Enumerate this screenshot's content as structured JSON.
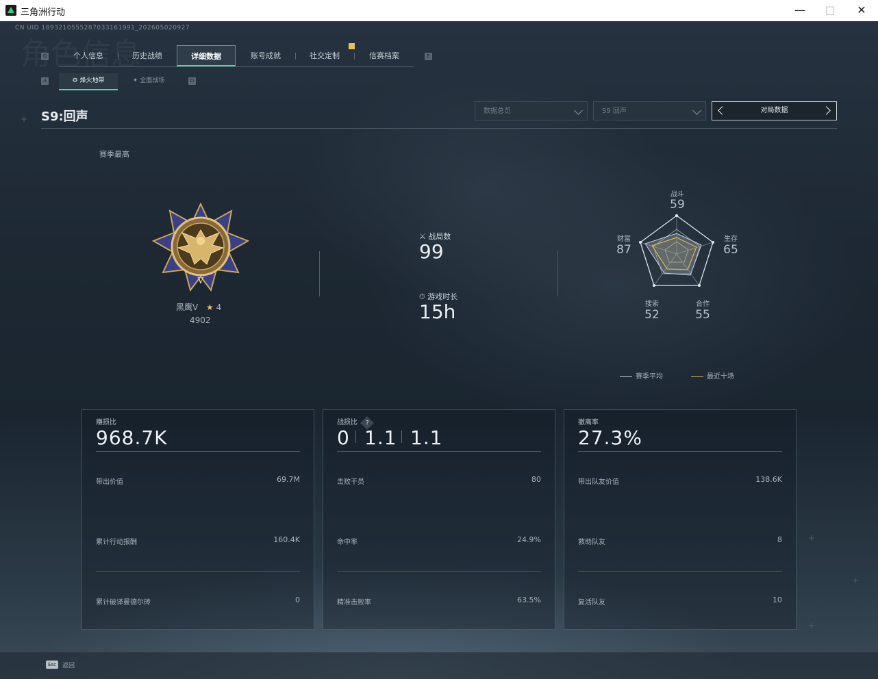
{
  "window": {
    "title": "三角洲行动"
  },
  "header": {
    "uid": "CN UID 1893210555287033161991_202605020927",
    "bg_title": "角色信息"
  },
  "tabs": [
    {
      "label": "个人信息"
    },
    {
      "label": "历史战绩"
    },
    {
      "label": "详细数据",
      "active": true
    },
    {
      "label": "账号成就"
    },
    {
      "label": "社交定制"
    },
    {
      "label": "信赛档案"
    }
  ],
  "key_hints": {
    "prev_tab": "Q",
    "next_tab": "E",
    "prev_sub": "A",
    "next_sub": "D"
  },
  "subtabs": [
    {
      "label": "烽火地带",
      "active": true
    },
    {
      "label": "全面战场"
    }
  ],
  "season_title": "S9:回声",
  "filters": {
    "scope": "数据总览",
    "season": "S9 回声",
    "pager_label": "对局数据"
  },
  "season_best_label": "赛季最高",
  "rank": {
    "name": "黑鹰V",
    "stars": "4",
    "score": "4902"
  },
  "stats": {
    "matches_label": "战局数",
    "matches_value": "99",
    "playtime_label": "游戏时长",
    "playtime_value": "15h"
  },
  "radar": {
    "axes": [
      {
        "label": "战斗",
        "value": "59"
      },
      {
        "label": "生存",
        "value": "65"
      },
      {
        "label": "合作",
        "value": "55"
      },
      {
        "label": "搜索",
        "value": "52"
      },
      {
        "label": "财富",
        "value": "87"
      }
    ],
    "legend": [
      {
        "label": "赛季平均",
        "color": "#c9d1d8"
      },
      {
        "label": "最近十场",
        "color": "#d8b756"
      }
    ]
  },
  "panels": [
    {
      "title": "赚损比",
      "big": "968.7K",
      "rows": [
        {
          "label": "带出价值",
          "value": "69.7M"
        },
        {
          "label": "累计行动报酬",
          "value": "160.4K"
        },
        {
          "label": "累计破译曼德尔砖",
          "value": "0"
        }
      ]
    },
    {
      "title": "战损比",
      "help": "?",
      "big_parts": [
        "0",
        "1.1",
        "1.1"
      ],
      "rows": [
        {
          "label": "击败干员",
          "value": "80"
        },
        {
          "label": "命中率",
          "value": "24.9%"
        },
        {
          "label": "精准击败率",
          "value": "63.5%"
        }
      ]
    },
    {
      "title": "撤离率",
      "big": "27.3%",
      "rows": [
        {
          "label": "带出队友价值",
          "value": "138.6K"
        },
        {
          "label": "救助队友",
          "value": "8"
        },
        {
          "label": "复活队友",
          "value": "10"
        }
      ]
    }
  ],
  "footer": {
    "esc_key": "Esc",
    "esc_label": "返回"
  }
}
